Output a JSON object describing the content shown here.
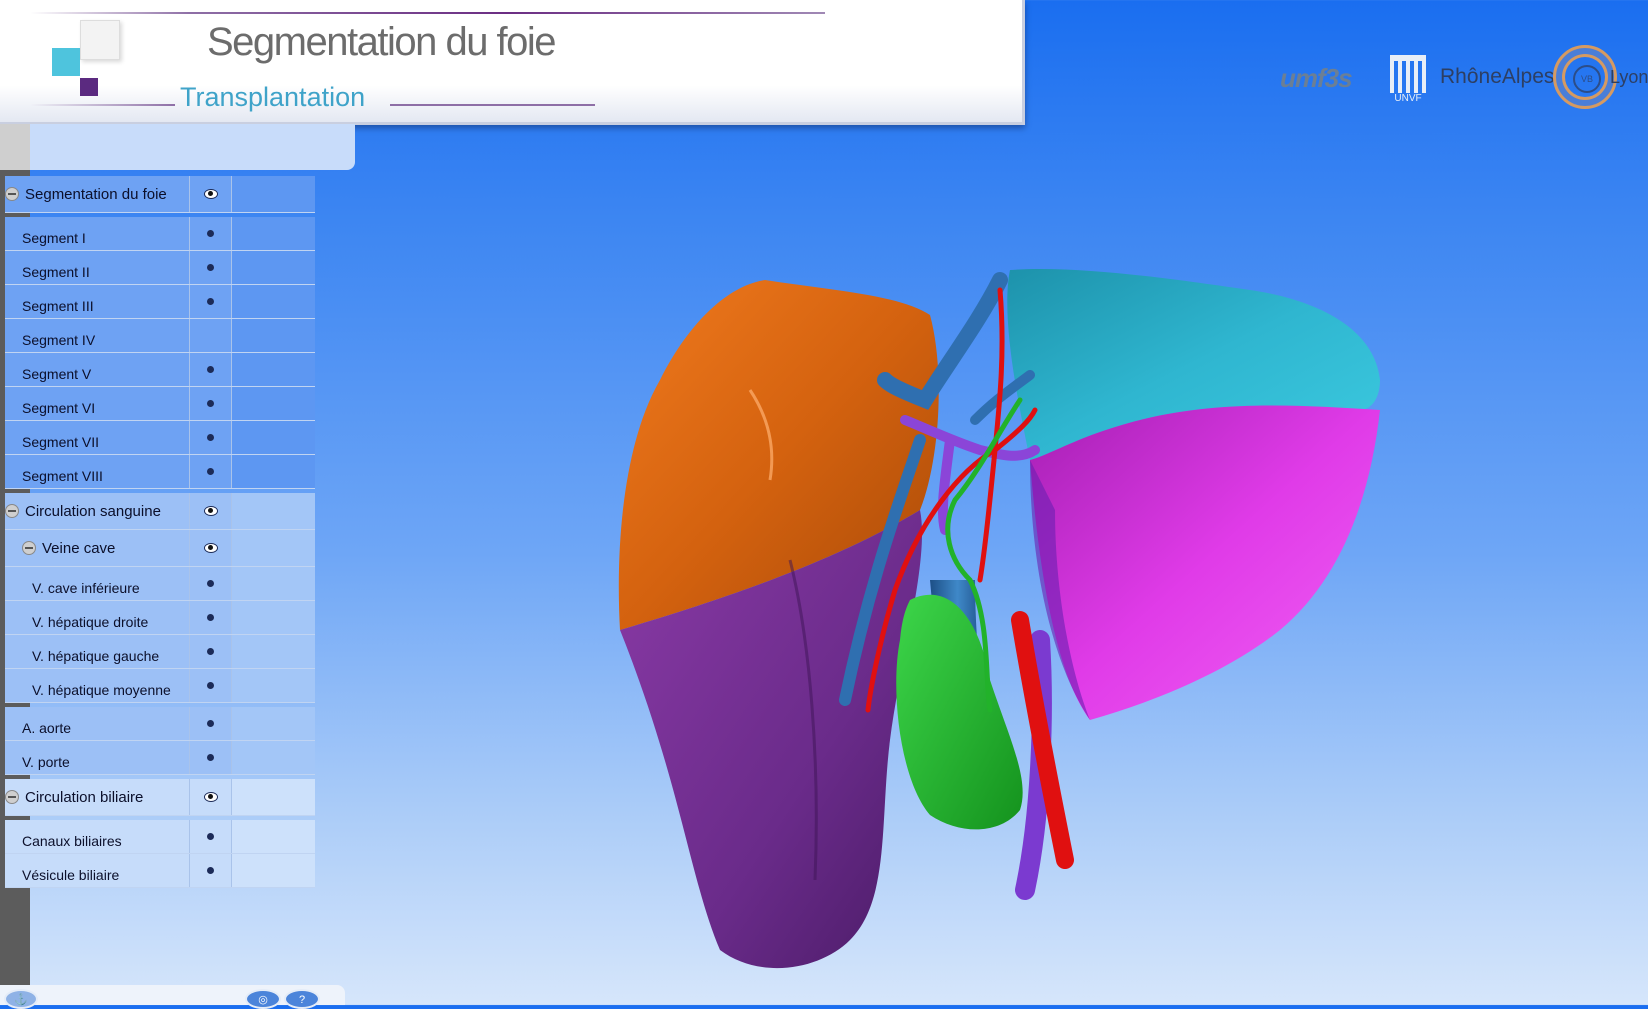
{
  "header": {
    "title": "Segmentation du foie",
    "subtitle": "Transplantation"
  },
  "logos": {
    "umf": "umf3s",
    "univ": "UNVF",
    "rhone": "RhôneAlpes",
    "circle": "VB",
    "lyon": "Lyon"
  },
  "tree": {
    "segmentation": {
      "label": "Segmentation du foie",
      "items": [
        "Segment I",
        "Segment II",
        "Segment III",
        "Segment IV",
        "Segment V",
        "Segment VI",
        "Segment VII",
        "Segment VIII"
      ]
    },
    "circulation_sanguine": {
      "label": "Circulation sanguine",
      "veine_cave": {
        "label": "Veine cave",
        "items": [
          "V. cave inférieure",
          "V. hépatique droite",
          "V. hépatique gauche",
          "V. hépatique moyenne"
        ]
      },
      "items": [
        "A. aorte",
        "V. porte"
      ]
    },
    "circulation_biliaire": {
      "label": "Circulation biliaire",
      "items": [
        "Canaux biliaires",
        "Vésicule biliaire"
      ]
    }
  },
  "bottom_toolbar": {
    "icons": [
      "anchor-icon",
      "target-icon",
      "help-icon"
    ],
    "help_label": "?"
  },
  "colors": {
    "segment_orange": "#d4620f",
    "segment_purple": "#6a2b8a",
    "segment_cyan": "#2fb6d0",
    "segment_magenta": "#e03be8",
    "vein_blue": "#2f6fb0",
    "artery_red": "#e01010",
    "bile_green": "#22b22a",
    "portal_violet": "#7b3ad0"
  }
}
